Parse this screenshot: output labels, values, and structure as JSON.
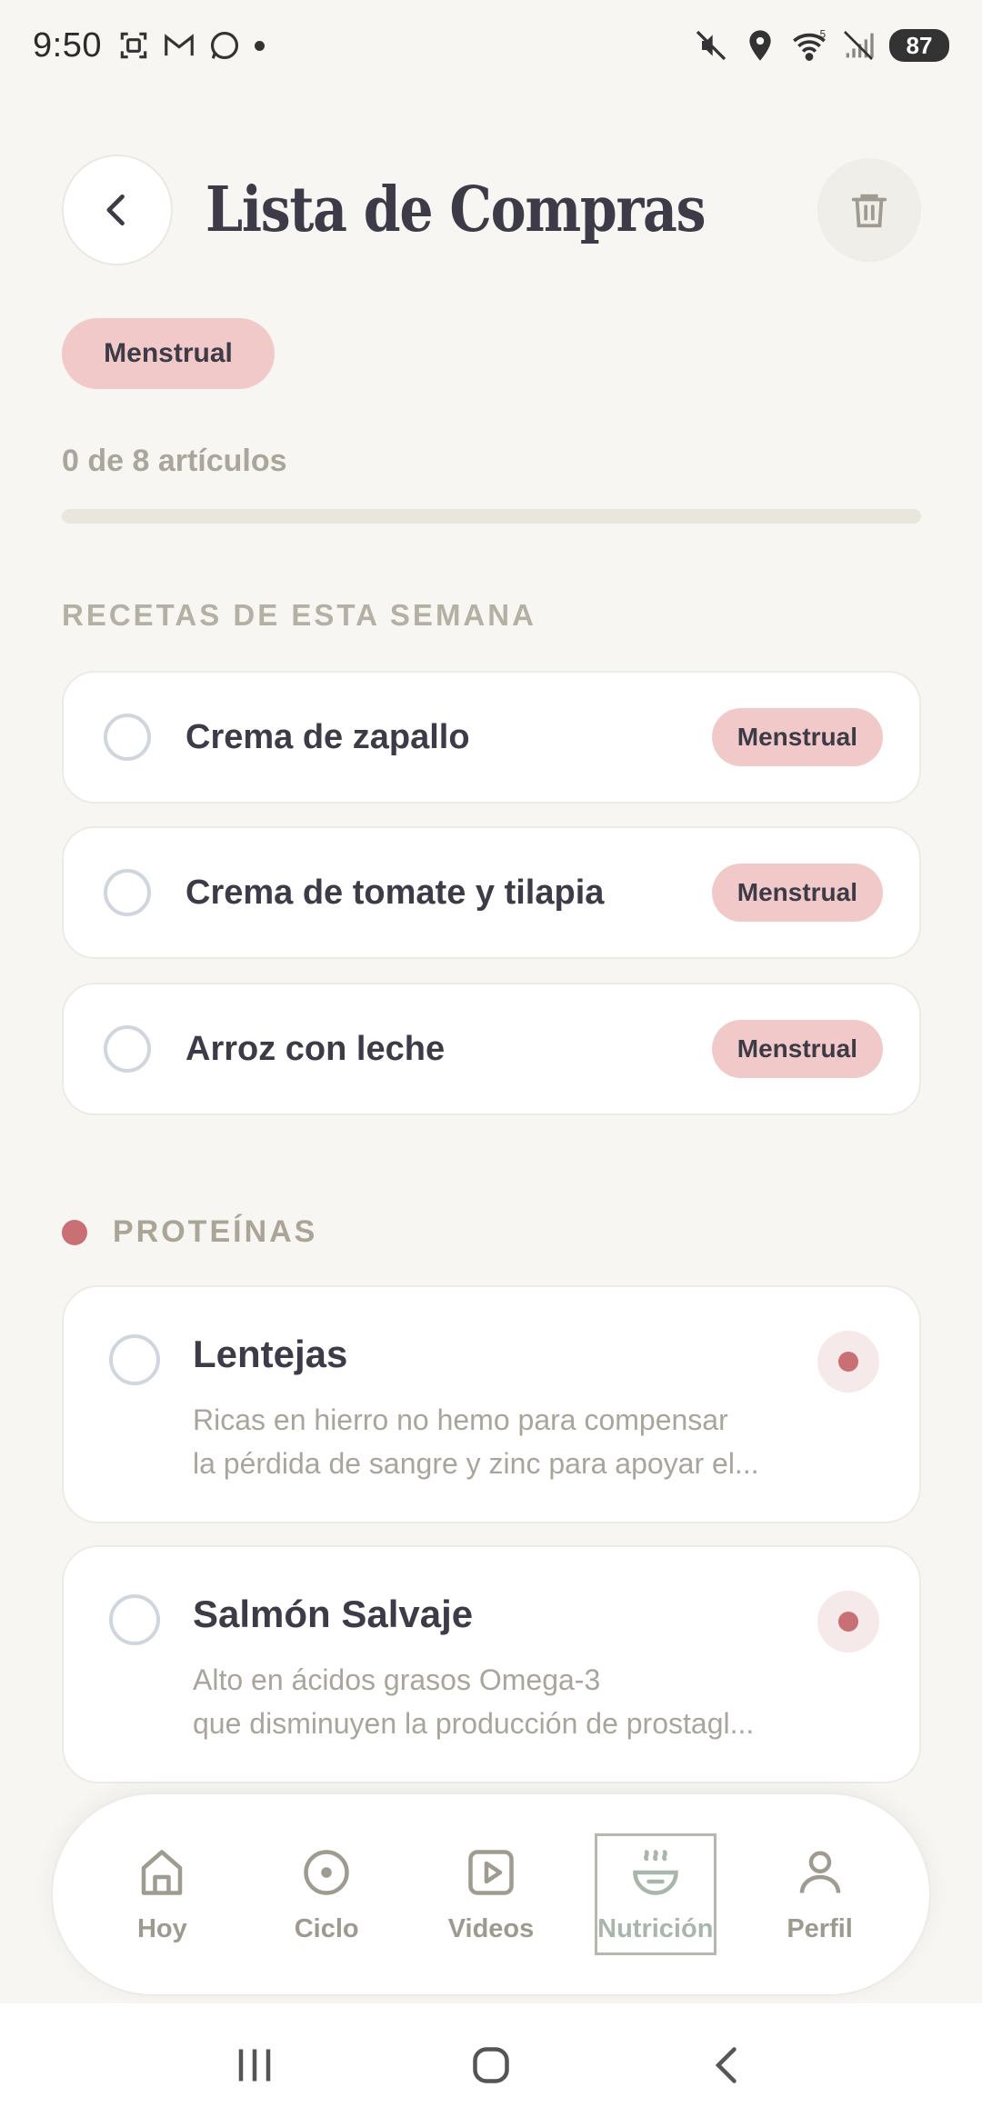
{
  "status_bar": {
    "time": "9:50",
    "battery": "87",
    "left_icons": [
      "screenshot-icon",
      "gmail-icon",
      "whatsapp-icon"
    ],
    "right_icons": [
      "mute-icon",
      "location-icon",
      "wifi-icon",
      "signal-icon"
    ],
    "wifi_label": "5"
  },
  "header": {
    "title": "Lista de Compras",
    "back_icon": "chevron-left-icon",
    "delete_icon": "trash-icon"
  },
  "phase_chip": "Menstrual",
  "progress": {
    "text": "0 de 8 artículos",
    "fraction": 0
  },
  "recipes_section": {
    "title": "RECETAS DE ESTA SEMANA",
    "items": [
      {
        "name": "Crema de zapallo",
        "tag": "Menstrual"
      },
      {
        "name": "Crema de tomate y tilapia",
        "tag": "Menstrual"
      },
      {
        "name": "Arroz con leche",
        "tag": "Menstrual"
      }
    ]
  },
  "category": {
    "title": "PROTEÍNAS",
    "items": [
      {
        "name": "Lentejas",
        "desc1": "Ricas en hierro no hemo para compensar",
        "desc2": "la pérdida de sangre y zinc para apoyar el..."
      },
      {
        "name": "Salmón Salvaje",
        "desc1": "Alto en ácidos grasos Omega-3",
        "desc2": "que disminuyen la producción de prostagl..."
      }
    ]
  },
  "bottom_nav": {
    "items": [
      {
        "label": "Hoy",
        "icon": "home-icon"
      },
      {
        "label": "Ciclo",
        "icon": "cycle-icon"
      },
      {
        "label": "Videos",
        "icon": "play-icon"
      },
      {
        "label": "Nutrición",
        "icon": "bowl-icon",
        "active": true
      },
      {
        "label": "Perfil",
        "icon": "person-icon"
      }
    ]
  },
  "colors": {
    "background": "#f7f6f2",
    "accent": "#c97074",
    "chip": "#f2c9c9",
    "text": "#3d3b48"
  }
}
